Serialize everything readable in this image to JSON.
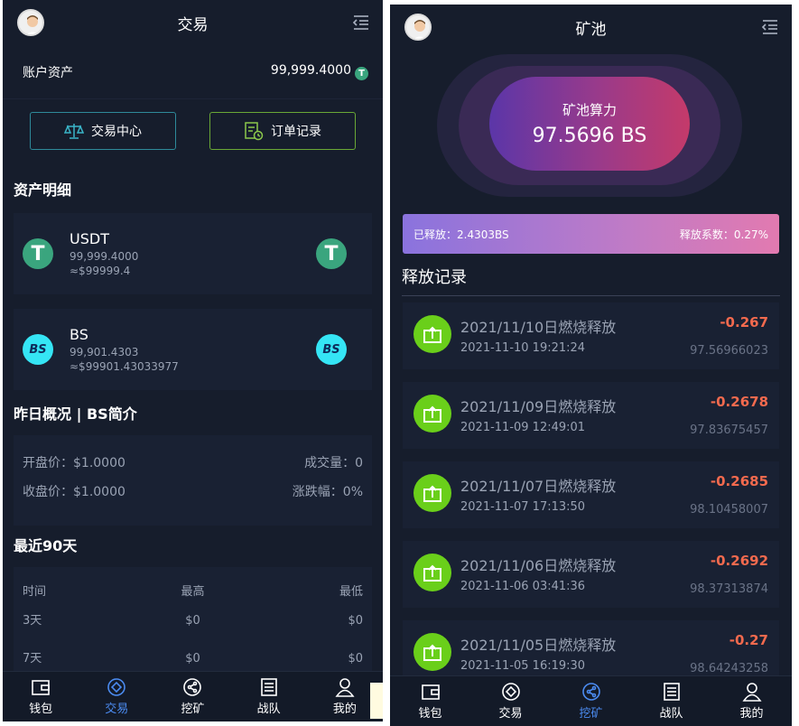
{
  "left": {
    "header": {
      "title": "交易"
    },
    "account": {
      "label": "账户资产",
      "value": "99,999.4000",
      "unit_icon": "T"
    },
    "buttons": {
      "trade_center": "交易中心",
      "order_records": "订单记录"
    },
    "assets_title": "资产明细",
    "coins": [
      {
        "name": "USDT",
        "amount": "99,999.4000",
        "approx": "≈$99999.4",
        "logo": "T"
      },
      {
        "name": "BS",
        "amount": "99,901.4303",
        "approx": "≈$99901.43033977",
        "logo": "BS"
      }
    ],
    "overview_title": "昨日概况 | BS简介",
    "overview": {
      "open": "开盘价：$1.0000",
      "volume": "成交量：0",
      "close": "收盘价：$1.0000",
      "change": "涨跌幅：0%"
    },
    "recent_title": "最近90天",
    "recent": {
      "headers": [
        "时间",
        "最高",
        "最低"
      ],
      "rows": [
        [
          "3天",
          "$0",
          "$0"
        ],
        [
          "7天",
          "$0",
          "$0"
        ]
      ]
    },
    "nav": [
      {
        "label": "钱包",
        "icon": "wallet-icon",
        "active": false
      },
      {
        "label": "交易",
        "icon": "trade-icon",
        "active": true
      },
      {
        "label": "挖矿",
        "icon": "mining-icon",
        "active": false
      },
      {
        "label": "战队",
        "icon": "team-icon",
        "active": false
      },
      {
        "label": "我的",
        "icon": "user-icon",
        "active": false
      }
    ]
  },
  "right": {
    "header": {
      "title": "矿池"
    },
    "pool": {
      "label": "矿池算力",
      "value": "97.5696 BS"
    },
    "release": {
      "released": "已释放：2.4303BS",
      "coef": "释放系数：0.27%"
    },
    "records_title": "释放记录",
    "records": [
      {
        "name": "2021/11/10日燃烧释放",
        "time": "2021-11-10 19:21:24",
        "amount": "-0.267",
        "balance": "97.56966023"
      },
      {
        "name": "2021/11/09日燃烧释放",
        "time": "2021-11-09 12:49:01",
        "amount": "-0.2678",
        "balance": "97.83675457"
      },
      {
        "name": "2021/11/07日燃烧释放",
        "time": "2021-11-07 17:13:50",
        "amount": "-0.2685",
        "balance": "98.10458007"
      },
      {
        "name": "2021/11/06日燃烧释放",
        "time": "2021-11-06 03:41:36",
        "amount": "-0.2692",
        "balance": "98.37313874"
      },
      {
        "name": "2021/11/05日燃烧释放",
        "time": "2021-11-05 16:19:30",
        "amount": "-0.27",
        "balance": "98.64243258"
      }
    ],
    "nav": [
      {
        "label": "钱包",
        "icon": "wallet-icon",
        "active": false
      },
      {
        "label": "交易",
        "icon": "trade-icon",
        "active": false
      },
      {
        "label": "挖矿",
        "icon": "mining-icon",
        "active": true
      },
      {
        "label": "战队",
        "icon": "team-icon",
        "active": false
      },
      {
        "label": "我的",
        "icon": "user-icon",
        "active": false
      }
    ]
  },
  "colors": {
    "background": "#161d2c",
    "card": "#192133",
    "active_nav": "#4b8bf0",
    "negative": "#f36a4e",
    "usdt": "#3aa57e",
    "bs": "#35e5f5",
    "record_icon": "#6acf1a"
  }
}
